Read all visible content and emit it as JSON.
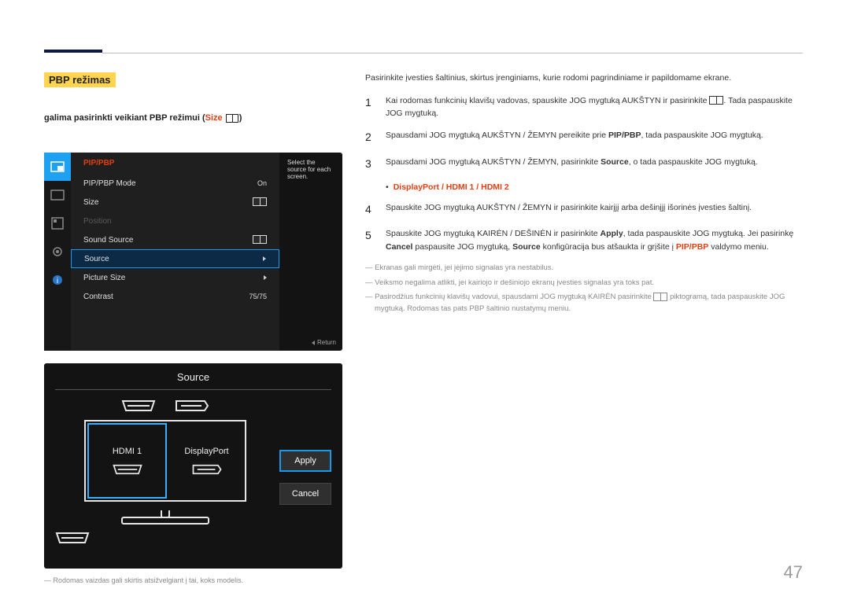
{
  "section_title": "PBP režimas",
  "subheading_lead": "galima pasirinkti veikiant PBP režimui ",
  "subheading_size": "Size",
  "osd": {
    "header": "PIP/PBP",
    "tip": "Select the source for each screen.",
    "return_label": "Return",
    "rows": {
      "mode_label": "PIP/PBP Mode",
      "mode_val": "On",
      "size_label": "Size",
      "position_label": "Position",
      "sound_label": "Sound Source",
      "source_label": "Source",
      "pic_label": "Picture Size",
      "contrast_label": "Contrast",
      "contrast_val": "75/75"
    }
  },
  "src": {
    "title": "Source",
    "hdmi": "HDMI 1",
    "dp": "DisplayPort",
    "apply": "Apply",
    "cancel": "Cancel"
  },
  "footnote": "― Rodomas vaizdas gali skirtis atsižvelgiant į tai, koks modelis.",
  "intro": "Pasirinkite įvesties šaltinius, skirtus įrenginiams, kurie rodomi pagrindiniame ir papildomame ekrane.",
  "steps": {
    "s1a": "Kai rodomas funkcinių klavišų vadovas, spauskite JOG mygtuką AUKŠTYN ir pasirinkite ",
    "s1b": ". Tada paspauskite JOG mygtuką.",
    "s2a": "Spausdami JOG mygtuką AUKŠTYN / ŽEMYN pereikite prie ",
    "s2b": "PIP/PBP",
    "s2c": ", tada paspauskite JOG mygtuką.",
    "s3a": "Spausdami JOG mygtuką AUKŠTYN / ŽEMYN, pasirinkite ",
    "s3b": "Source",
    "s3c": ", o tada paspauskite JOG mygtuką.",
    "opt": "DisplayPort / HDMI 1 / HDMI 2",
    "s4": "Spauskite JOG mygtuką AUKŠTYN / ŽEMYN ir pasirinkite kairįjį arba dešinįjį išorinės įvesties šaltinį.",
    "s5a": "Spauskite JOG mygtuką KAIRĖN / DEŠINĖN ir pasirinkite ",
    "s5b": "Apply",
    "s5c": ", tada paspauskite JOG mygtuką. Jei pasirinkę ",
    "s5d": "Cancel",
    "s5e": " paspausite JOG mygtuką, ",
    "s5f": "Source",
    "s5g": " konfigūracija bus atšaukta ir grįšite į ",
    "s5h": "PIP/PBP",
    "s5i": " valdymo meniu."
  },
  "notes": {
    "n1": "― Ekranas gali mirgėti, jei įėjimo signalas yra nestabilus.",
    "n2": "― Veiksmo negalima atlikti, jei kairiojo ir dešiniojo ekranų įvesties signalas yra toks pat.",
    "n3a": "― Pasirodžius funkcinių klavišų vadovui, spausdami JOG mygtuką KAIRĖN pasirinkite ",
    "n3b": " piktogramą, tada paspauskite JOG mygtuką. Rodomas tas pats PBP šaltinio nustatymų meniu."
  },
  "page": "47"
}
